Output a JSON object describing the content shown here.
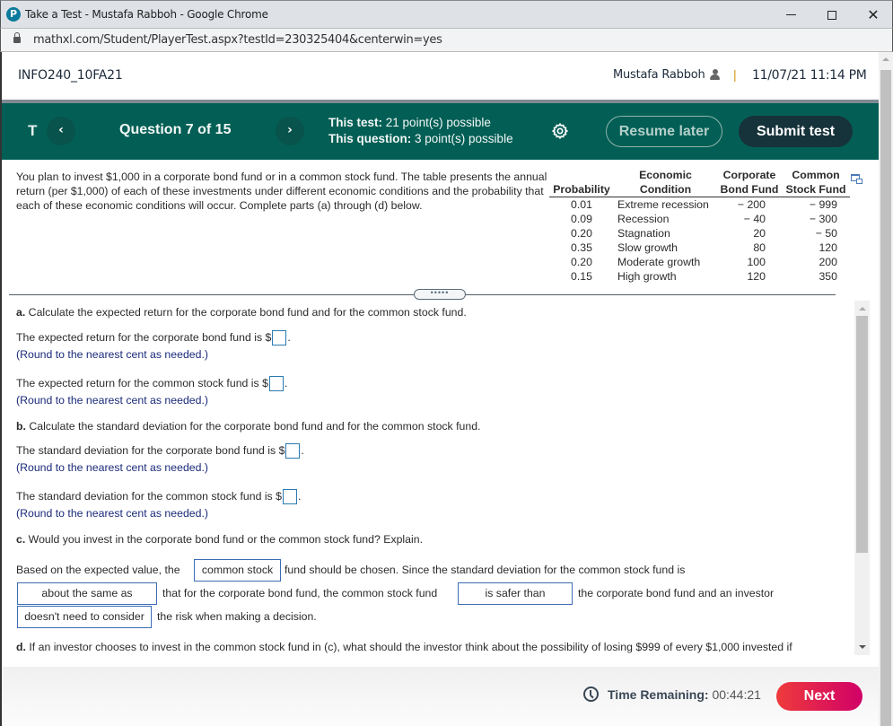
{
  "browser": {
    "window_title": "Take a Test - Mustafa Rabboh - Google Chrome",
    "logo_letter": "P",
    "url": "mathxl.com/Student/PlayerTest.aspx?testId=230325404&centerwin=yes",
    "minimize_symbol": "",
    "close_symbol": "✕"
  },
  "header": {
    "course": "INFO240_10FA21",
    "user_name": "Mustafa Rabboh",
    "separator": "|",
    "datetime": "11/07/21 11:14 PM"
  },
  "question_bar": {
    "test_initial": "T",
    "prev_symbol": "‹",
    "next_symbol": "›",
    "question_label": "Question 7 of 15",
    "test_points_label": "This test:",
    "test_points_value": "21 point(s) possible",
    "question_points_label": "This question:",
    "question_points_value": "3 point(s) possible",
    "resume_label": "Resume later",
    "submit_label": "Submit test"
  },
  "problem": {
    "intro": "You plan to invest $1,000 in a corporate bond fund or in a common stock fund. The table presents the annual return (per $1,000) of each of these investments under different economic conditions and the probability that each of these economic conditions will occur. Complete parts (a) through (d) below.",
    "table": {
      "headers": {
        "probability": "Probability",
        "condition_line1": "Economic",
        "condition_line2": "Condition",
        "bond_line1": "Corporate",
        "bond_line2": "Bond Fund",
        "stock_line1": "Common",
        "stock_line2": "Stock Fund"
      },
      "rows": [
        {
          "probability": "0.01",
          "condition": "Extreme recession",
          "bond": "− 200",
          "stock": "− 999"
        },
        {
          "probability": "0.09",
          "condition": "Recession",
          "bond": "− 40",
          "stock": "− 300"
        },
        {
          "probability": "0.20",
          "condition": "Stagnation",
          "bond": "20",
          "stock": "− 50"
        },
        {
          "probability": "0.35",
          "condition": "Slow growth",
          "bond": "80",
          "stock": "120"
        },
        {
          "probability": "0.20",
          "condition": "Moderate growth",
          "bond": "100",
          "stock": "200"
        },
        {
          "probability": "0.15",
          "condition": "High growth",
          "bond": "120",
          "stock": "350"
        }
      ]
    },
    "divider_handle": "•••••"
  },
  "parts": {
    "a_label": "a.",
    "a_text": " Calculate the expected return for the corporate bond fund and for the common stock fund.",
    "a1_text": "The expected return for the corporate bond fund is $",
    "a1_value": "",
    "a2_text": "The expected return for the common stock fund is $",
    "a2_value": "",
    "round_hint": "(Round to the nearest cent as needed.)",
    "b_label": "b.",
    "b_text": " Calculate the standard deviation for the corporate bond fund and for the common stock fund.",
    "b1_text": "The standard deviation for the corporate bond fund is $",
    "b1_value": "",
    "b2_text": "The standard deviation for the common stock fund is $",
    "b2_value": "",
    "c_label": "c.",
    "c_text": " Would you invest in the corporate bond fund or the common stock fund? Explain.",
    "c_sentence_1": "Based on the expected value, the",
    "c_choice_1": "common stock",
    "c_sentence_2": "fund should be chosen. Since the standard deviation for the common stock fund is",
    "c_choice_2": "about the same as",
    "c_sentence_3": "that for the corporate bond fund, the common stock fund",
    "c_choice_3": "is safer than",
    "c_sentence_4": "the corporate bond fund and an investor",
    "c_choice_4": "doesn't need to consider",
    "c_sentence_5": "the risk when making a decision.",
    "d_label": "d.",
    "d_text": " If an investor chooses to invest in the common stock fund in (c), what should the investor think about the possibility of losing $999 of every $1,000 invested if"
  },
  "footer": {
    "time_label": "Time Remaining:",
    "time_value": "00:44:21",
    "next_label": "Next"
  }
}
